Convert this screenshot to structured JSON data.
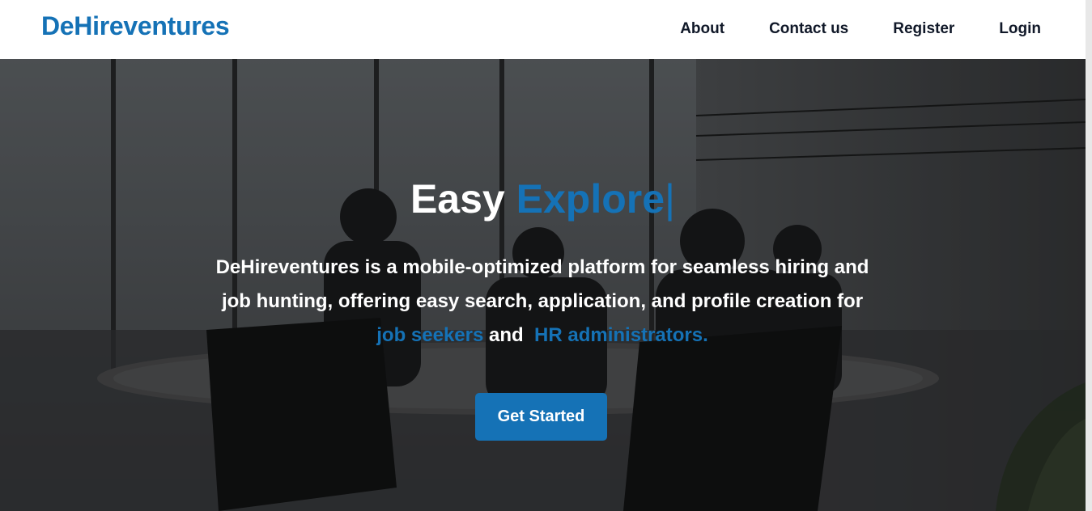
{
  "nav": {
    "brand": "DeHireventures",
    "links": [
      "About",
      "Contact us",
      "Register",
      "Login"
    ]
  },
  "hero": {
    "title_static": "Easy",
    "title_rotating": "Explore",
    "cursor": "|",
    "desc_line1": "DeHireventures is a mobile-optimized platform for seamless hiring and",
    "desc_line2": "job hunting, offering easy search, application, and profile creation for",
    "highlight_job_seekers": "job seekers",
    "and_word": "and",
    "highlight_hr": "HR administrators.",
    "cta_label": "Get Started"
  },
  "colors": {
    "accent": "#1572b6",
    "nav_text": "#101828",
    "hero_text": "#ffffff"
  }
}
